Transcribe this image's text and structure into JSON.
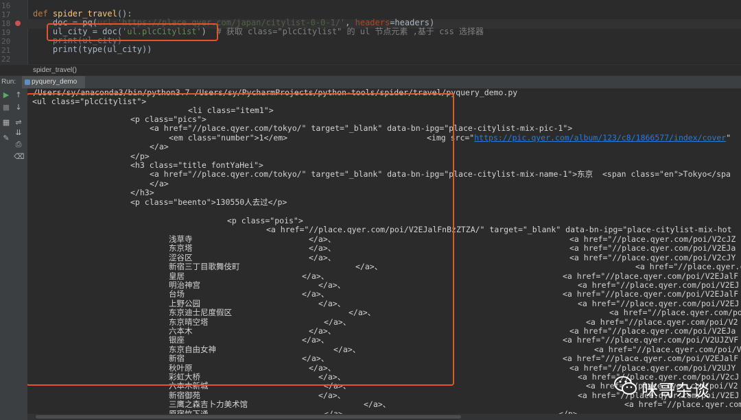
{
  "editor": {
    "line_numbers": [
      "16",
      "17",
      "18",
      "19",
      "20",
      "21",
      "22"
    ],
    "lines": [
      {
        "kw": "def ",
        "fn": "spider_travel",
        "rest": "():"
      },
      {
        "p1": "    doc = pq(",
        "param": "url=",
        "str": "'https://place.qyer.com/japan/citylist-0-0-1/'",
        "p2": ", ",
        "param2": "headers",
        "p3": "=headers)"
      },
      {
        "p1": "    ul_city = doc(",
        "str": "'ul.plcCitylist'",
        "p2": ")  ",
        "cmt": "# 获取 class=\"plcCitylist\" 的 ul 节点元素 ,基于 css 选择器"
      },
      {
        "text": "    print(ul_city)"
      },
      {
        "text": "    print(type(ul_city))"
      }
    ]
  },
  "breadcrumb": "spider_travel()",
  "run": {
    "label": "Run:",
    "tab": "pyquery_demo"
  },
  "console": {
    "command": "/Users/sy/anaconda3/bin/python3.7 /Users/sy/PycharmProjects/python-tools/spider/travel/pyquery_demo.py",
    "ul_open": "<ul class=\"plcCitylist\">",
    "li_open": "<li class=\"item1\">",
    "p_pics": "<p class=\"pics\">",
    "a_pic": "<a href=\"//place.qyer.com/tokyo/\" target=\"_blank\" data-bn-ipg=\"place-citylist-mix-pic-1\">",
    "em": "<em class=\"number\">1</em>",
    "img_pre": "<img src=\"",
    "img_link": "https://pic.qyer.com/album/123/c8/1866577/index/cover",
    "img_post": "\"",
    "a_close": "</a>",
    "p_close": "</p>",
    "h3": "<h3 class=\"title fontYaHei\">",
    "a_name": "<a href=\"//place.qyer.com/tokyo/\" target=\"_blank\" data-bn-ipg=\"place-citylist-mix-name-1\">东京  <span class=\"en\">Tokyo</spa",
    "a_close2": "</a>",
    "h3_close": "</h3>",
    "beento": "<p class=\"beento\">130550人去过</p>",
    "pois": "<p class=\"pois\">",
    "a_pois": "<a href=\"//place.qyer.com/poi/V2EJalFnBzZTZA/\" target=\"_blank\" data-bn-ipg=\"place-citylist-mix-hot",
    "poi_rows": [
      {
        "name": "浅草寺",
        "close": "</a>、",
        "right": "<a href=\"//place.qyer.com/poi/V2cJZ"
      },
      {
        "name": "东京塔",
        "close": "</a>、",
        "right": "<a href=\"//place.qyer.com/poi/V2EJa"
      },
      {
        "name": "涩谷区",
        "close": "</a>、",
        "right": "<a href=\"//place.qyer.com/poi/V2cJY"
      },
      {
        "name": "新宿三丁目歌舞伎町",
        "close": "</a>、",
        "right": "<a href=\"//place.qyer.com/"
      },
      {
        "name": "皇居",
        "close": "</a>、",
        "right": "<a href=\"//place.qyer.com/poi/V2EJalF"
      },
      {
        "name": "明治神宫",
        "close": "</a>、",
        "right": "<a href=\"//place.qyer.com/poi/V2EJ"
      },
      {
        "name": "台场",
        "close": "</a>、",
        "right": "<a href=\"//place.qyer.com/poi/V2EJalF"
      },
      {
        "name": "上野公园",
        "close": "</a>、",
        "right": "<a href=\"//place.qyer.com/poi/V2EJ"
      },
      {
        "name": "东京迪士尼度假区",
        "close": "</a>、",
        "right": "<a href=\"//place.qyer.com/po"
      },
      {
        "name": "东京晴空塔",
        "close": "</a>、",
        "right": "<a href=\"//place.qyer.com/poi/V2"
      },
      {
        "name": "六本木",
        "close": "</a>、",
        "right": "<a href=\"//place.qyer.com/poi/V2EJa"
      },
      {
        "name": "银座",
        "close": "</a>、",
        "right": "<a href=\"//place.qyer.com/poi/V2UJZVF"
      },
      {
        "name": "东京自由女神",
        "close": "</a>、",
        "right": "<a href=\"//place.qyer.com/poi/V"
      },
      {
        "name": "新宿",
        "close": "</a>、",
        "right": "<a href=\"//place.qyer.com/poi/V2EJalF"
      },
      {
        "name": "秋叶原",
        "close": "</a>、",
        "right": "<a href=\"//place.qyer.com/poi/V2UJY"
      },
      {
        "name": "彩虹大桥",
        "close": "</a>、",
        "right": "<a href=\"//place.qyer.com/poi/V2cJ"
      },
      {
        "name": "六本木新城",
        "close": "</a>、",
        "right": "<a href=\"//place.qyer.com/poi/V2"
      },
      {
        "name": "新宿御苑",
        "close": "</a>、",
        "right": "<a href=\"//place.qyer.com/poi/V2EJ"
      },
      {
        "name": "三鹰之森吉卜力美术馆",
        "close": "</a>、",
        "right": "<a href=\"//place.qyer.com/"
      },
      {
        "name": "原宿竹下通",
        "close": "</a>、",
        "right": "</p>"
      }
    ]
  },
  "watermark": {
    "text": "咪哥杂谈"
  },
  "colors": {
    "accent_box": "#e2552d",
    "background": "#2b2b2b",
    "link": "#287bde"
  }
}
